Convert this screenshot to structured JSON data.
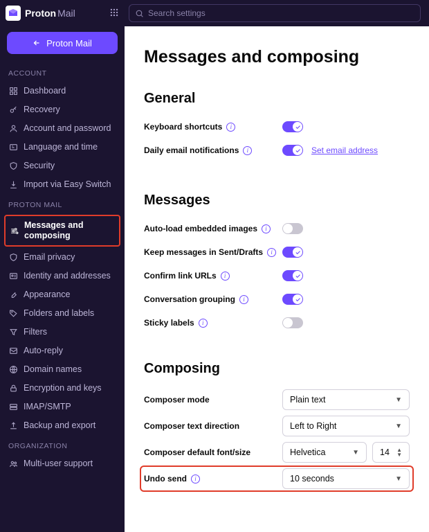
{
  "brand": {
    "name": "Proton",
    "product": "Mail"
  },
  "search": {
    "placeholder": "Search settings"
  },
  "back_button": "Proton Mail",
  "sidebar": {
    "account_header": "ACCOUNT",
    "account_items": [
      {
        "label": "Dashboard"
      },
      {
        "label": "Recovery"
      },
      {
        "label": "Account and password"
      },
      {
        "label": "Language and time"
      },
      {
        "label": "Security"
      },
      {
        "label": "Import via Easy Switch"
      }
    ],
    "mail_header": "PROTON MAIL",
    "mail_items": [
      {
        "label": "Messages and composing",
        "active": true
      },
      {
        "label": "Email privacy"
      },
      {
        "label": "Identity and addresses"
      },
      {
        "label": "Appearance"
      },
      {
        "label": "Folders and labels"
      },
      {
        "label": "Filters"
      },
      {
        "label": "Auto-reply"
      },
      {
        "label": "Domain names"
      },
      {
        "label": "Encryption and keys"
      },
      {
        "label": "IMAP/SMTP"
      },
      {
        "label": "Backup and export"
      }
    ],
    "org_header": "ORGANIZATION",
    "org_items": [
      {
        "label": "Multi-user support"
      }
    ]
  },
  "page": {
    "title": "Messages and composing",
    "sections": {
      "general": {
        "title": "General",
        "keyboard_shortcuts": {
          "label": "Keyboard shortcuts",
          "on": true
        },
        "daily_notifications": {
          "label": "Daily email notifications",
          "on": true,
          "link": "Set email address"
        }
      },
      "messages": {
        "title": "Messages",
        "rows": [
          {
            "label": "Auto-load embedded images",
            "on": false
          },
          {
            "label": "Keep messages in Sent/Drafts",
            "on": true
          },
          {
            "label": "Confirm link URLs",
            "on": true
          },
          {
            "label": "Conversation grouping",
            "on": true
          },
          {
            "label": "Sticky labels",
            "on": false
          }
        ]
      },
      "composing": {
        "title": "Composing",
        "composer_mode": {
          "label": "Composer mode",
          "value": "Plain text"
        },
        "text_direction": {
          "label": "Composer text direction",
          "value": "Left to Right"
        },
        "font": {
          "label": "Composer default font/size",
          "value": "Helvetica",
          "size": "14"
        },
        "undo_send": {
          "label": "Undo send",
          "value": "10 seconds"
        }
      }
    }
  }
}
